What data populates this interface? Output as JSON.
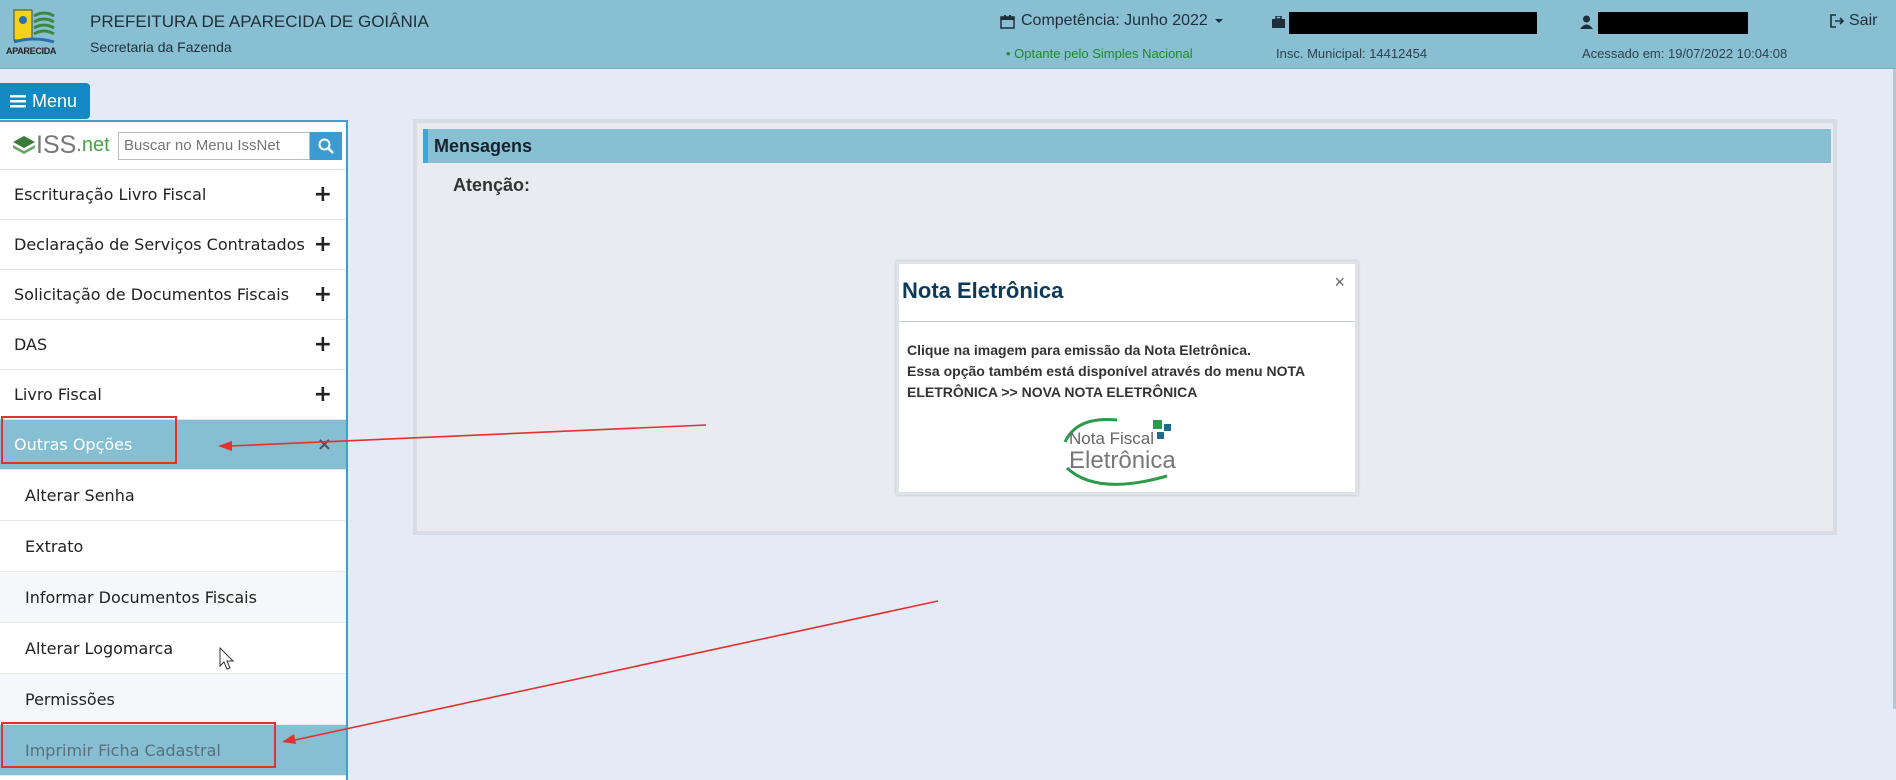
{
  "header": {
    "logo_text": "APARECIDA",
    "org_title": "PREFEITURA DE APARECIDA DE GOIÂNIA",
    "org_subtitle": "Secretaria da Fazenda",
    "competencia": "Competência: Junho 2022",
    "simples": "• Optante pelo Simples Nacional",
    "inscricao": "Insc. Municipal: 14412454",
    "acesso": "Acessado em: 19/07/2022 10:04:08",
    "sair": "Sair"
  },
  "menu_button": {
    "label": "Menu"
  },
  "sidebar": {
    "logo_iss": "ISS",
    "logo_net": ".net",
    "search_placeholder": "Buscar no Menu IssNet",
    "items": [
      {
        "label": "Escrituração Livro Fiscal",
        "icon": "+"
      },
      {
        "label": "Declaração de Serviços Contratados",
        "icon": "+"
      },
      {
        "label": "Solicitação de Documentos Fiscais",
        "icon": "+"
      },
      {
        "label": "DAS",
        "icon": "+"
      },
      {
        "label": "Livro Fiscal",
        "icon": "+"
      },
      {
        "label": "Outras Opções",
        "icon": "×"
      }
    ],
    "sub_items": [
      {
        "label": "Alterar Senha"
      },
      {
        "label": "Extrato"
      },
      {
        "label": "Informar Documentos Fiscais"
      },
      {
        "label": "Alterar Logomarca"
      },
      {
        "label": "Permissões"
      },
      {
        "label": "Imprimir Ficha Cadastral"
      }
    ]
  },
  "messages": {
    "title": "Mensagens",
    "atencao": "Atenção:"
  },
  "dialog": {
    "title": "Nota Eletrônica",
    "close": "×",
    "line1": "Clique na imagem para emissão da Nota Eletrônica.",
    "line2": "Essa opção também está disponível através do menu NOTA ELETRÔNICA >> NOVA NOTA ELETRÔNICA",
    "logo_line1": "Nota Fiscal",
    "logo_line2": "Eletrônica"
  },
  "colors": {
    "header_bg": "#89bfd2",
    "menu_button_bg": "#1389c4",
    "active_item_bg": "#86bfd3",
    "annotation_red": "#e53030",
    "simples_green": "#1e8a2a"
  }
}
